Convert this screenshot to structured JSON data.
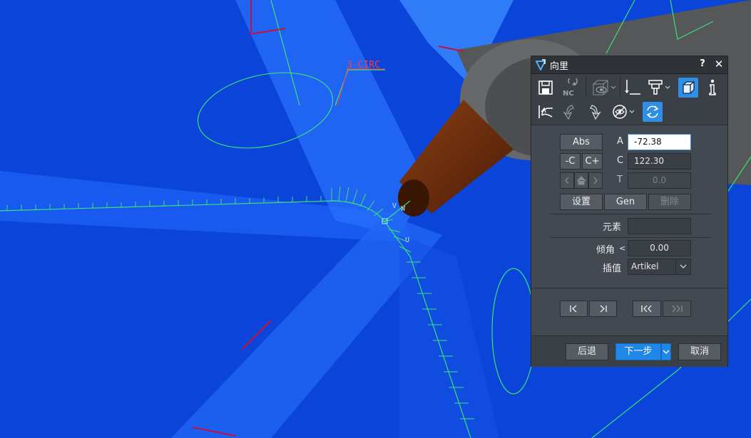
{
  "viewport": {
    "annotation": "3-CIRC",
    "axis_label_v": "V",
    "axis_label_w": "W",
    "axis_label_u": "U"
  },
  "dialog": {
    "title": "向里",
    "help": "?",
    "close": "✕",
    "toolbar_row1": [
      "save-icon",
      "nc-icon",
      "view-cube-icon",
      "measure-icon",
      "tool-icon",
      "cube-icon",
      "info-icon"
    ],
    "toolbar_row1_nc_label": "NC",
    "toolbar_row2": [
      "return-icon",
      "rotate-left-icon",
      "rotate-right-icon",
      "visibility-icon",
      "refresh-icon"
    ],
    "abs_label": "Abs",
    "minus_c_label": "-C",
    "plus_c_label": "C+",
    "field_a_label": "A",
    "field_a_value": "-72.38",
    "field_c_label": "C",
    "field_c_value": "122.30",
    "field_t_label": "T",
    "field_t_value": "0.0",
    "settings_label": "设置",
    "gen_label": "Gen",
    "delete_label": "删除",
    "element_label": "元素",
    "element_value": "",
    "tilt_label": "倾角",
    "tilt_symbol": "<",
    "tilt_value": "0.00",
    "interp_label": "插值",
    "interp_value": "Artikel",
    "back_label": "后退",
    "next_label": "下一步",
    "cancel_label": "取消",
    "colors": {
      "accent": "#1f87e8",
      "viewport_bg": "#0a44d8",
      "toolpath": "#39e07a",
      "label": "#ff3c3c",
      "tool_body": "#5b5b5b",
      "tool_tip": "#6e2f0c"
    }
  }
}
